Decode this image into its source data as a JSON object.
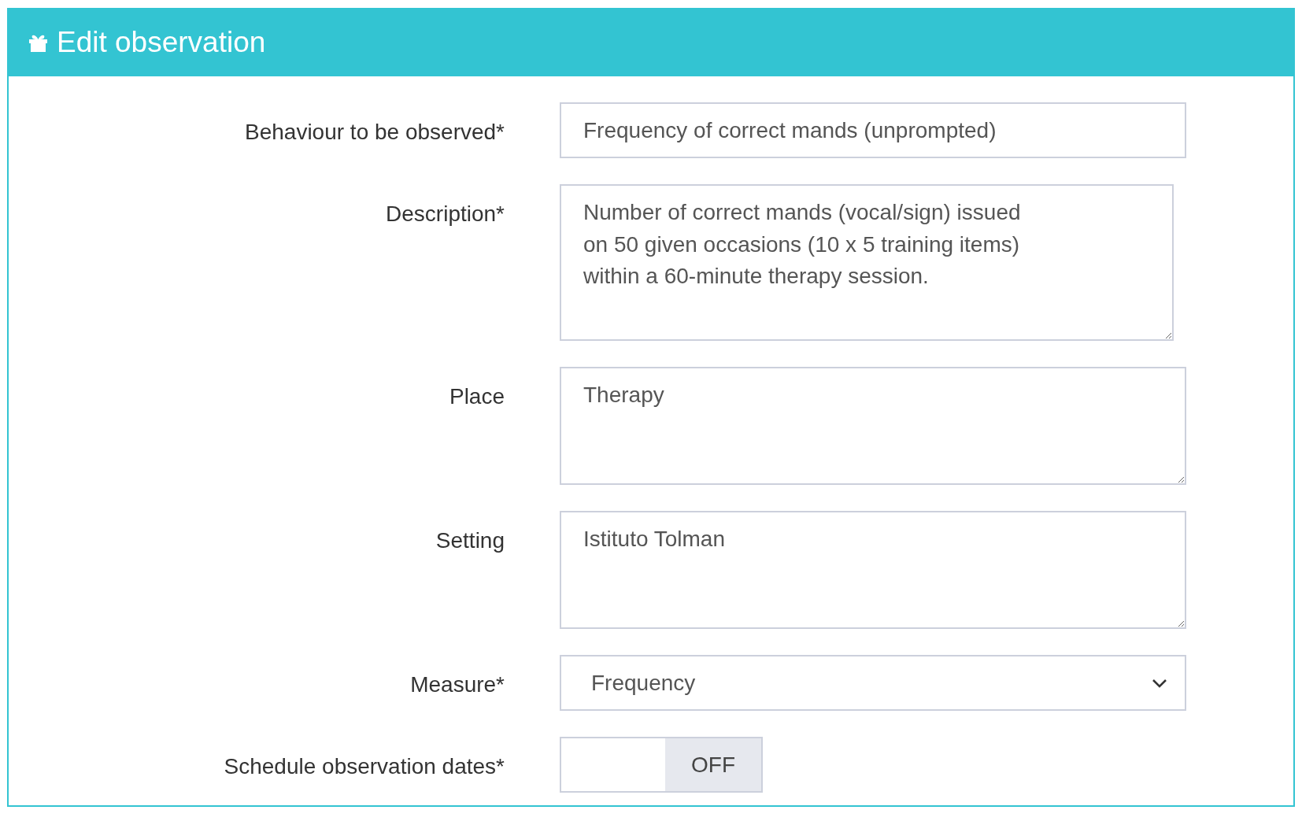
{
  "panel": {
    "title": "Edit observation"
  },
  "fields": [
    {
      "kind": "input",
      "label": "Behaviour to be observed*",
      "value": "Frequency of correct mands (unprompted)"
    },
    {
      "kind": "textarea",
      "label": "Description*",
      "value": "Number of correct mands (vocal/sign) issued\non 50 given occasions (10 x 5 training items)\nwithin a 60-minute therapy session."
    },
    {
      "kind": "textarea",
      "label": "Place",
      "value": "Therapy"
    },
    {
      "kind": "textarea",
      "label": "Setting",
      "value": "Istituto Tolman"
    },
    {
      "kind": "select",
      "label": "Measure*",
      "value": "Frequency"
    },
    {
      "kind": "toggle",
      "label": "Schedule observation dates*",
      "on": false,
      "state_label": "OFF"
    }
  ]
}
